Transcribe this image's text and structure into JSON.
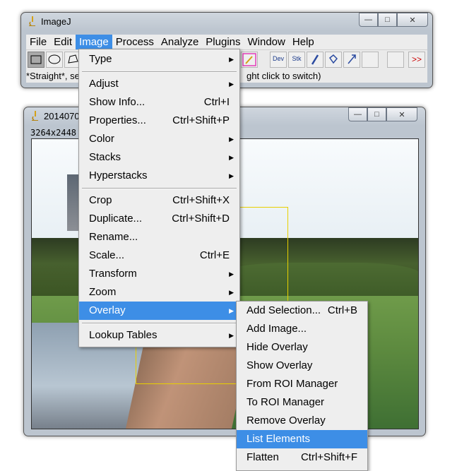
{
  "main_window": {
    "title": "ImageJ",
    "menubar": [
      "File",
      "Edit",
      "Image",
      "Process",
      "Analyze",
      "Plugins",
      "Window",
      "Help"
    ],
    "active_menu": "Image",
    "toolbar": {
      "dev_label": "Dev",
      "stk_label": "Stk",
      "more_label": ">>"
    },
    "status_left": "*Straight*, se",
    "status_right": "ght click to switch)"
  },
  "image_window": {
    "title": "20140704",
    "info": "3264x2448"
  },
  "image_menu": {
    "items": [
      {
        "label": "Type",
        "shortcut": "",
        "submenu": true
      },
      {
        "label": "Adjust",
        "shortcut": "",
        "submenu": true
      },
      {
        "label": "Show Info...",
        "shortcut": "Ctrl+I",
        "submenu": false
      },
      {
        "label": "Properties...",
        "shortcut": "Ctrl+Shift+P",
        "submenu": false
      },
      {
        "label": "Color",
        "shortcut": "",
        "submenu": true
      },
      {
        "label": "Stacks",
        "shortcut": "",
        "submenu": true
      },
      {
        "label": "Hyperstacks",
        "shortcut": "",
        "submenu": true
      },
      {
        "label": "Crop",
        "shortcut": "Ctrl+Shift+X",
        "submenu": false
      },
      {
        "label": "Duplicate...",
        "shortcut": "Ctrl+Shift+D",
        "submenu": false
      },
      {
        "label": "Rename...",
        "shortcut": "",
        "submenu": false
      },
      {
        "label": "Scale...",
        "shortcut": "Ctrl+E",
        "submenu": false
      },
      {
        "label": "Transform",
        "shortcut": "",
        "submenu": true
      },
      {
        "label": "Zoom",
        "shortcut": "",
        "submenu": true
      },
      {
        "label": "Overlay",
        "shortcut": "",
        "submenu": true
      },
      {
        "label": "Lookup Tables",
        "shortcut": "",
        "submenu": true
      }
    ],
    "highlighted": "Overlay"
  },
  "overlay_menu": {
    "items": [
      {
        "label": "Add Selection...",
        "shortcut": "Ctrl+B"
      },
      {
        "label": "Add Image...",
        "shortcut": ""
      },
      {
        "label": "Hide Overlay",
        "shortcut": ""
      },
      {
        "label": "Show Overlay",
        "shortcut": ""
      },
      {
        "label": "From ROI Manager",
        "shortcut": ""
      },
      {
        "label": "To ROI Manager",
        "shortcut": ""
      },
      {
        "label": "Remove Overlay",
        "shortcut": ""
      },
      {
        "label": "List Elements",
        "shortcut": ""
      },
      {
        "label": "Flatten",
        "shortcut": "Ctrl+Shift+F"
      }
    ],
    "highlighted": "List Elements"
  },
  "colors": {
    "highlight": "#3d8ee6",
    "roi": "#e8d000",
    "more_arrows": "#cc0000"
  },
  "icons": {
    "app": "microscope-icon",
    "minimize": "minimize-icon",
    "maximize": "maximize-icon",
    "close": "close-icon",
    "submenu": "triangle-right-icon"
  }
}
